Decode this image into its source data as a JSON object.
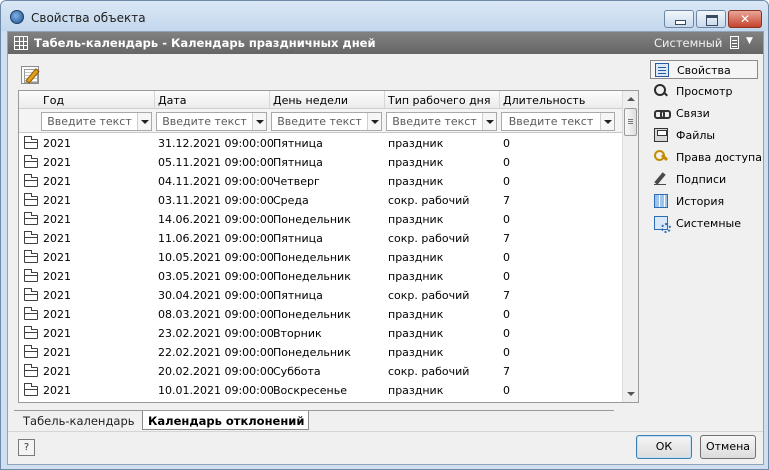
{
  "window": {
    "title": "Свойства объекта"
  },
  "header": {
    "title": "Табель-календарь - Календарь праздничных дней",
    "right_label": "Системный"
  },
  "grid": {
    "columns": [
      "Год",
      "Дата",
      "День недели",
      "Тип рабочего дня",
      "Длительность"
    ],
    "filter_placeholder": "Введите текст",
    "rows": [
      [
        "2021",
        "31.12.2021 09:00:00",
        "Пятница",
        "праздник",
        "0"
      ],
      [
        "2021",
        "05.11.2021 09:00:00",
        "Пятница",
        "праздник",
        "0"
      ],
      [
        "2021",
        "04.11.2021 09:00:00",
        "Четверг",
        "праздник",
        "0"
      ],
      [
        "2021",
        "03.11.2021 09:00:00",
        "Среда",
        "сокр. рабочий",
        "7"
      ],
      [
        "2021",
        "14.06.2021 09:00:00",
        "Понедельник",
        "праздник",
        "0"
      ],
      [
        "2021",
        "11.06.2021 09:00:00",
        "Пятница",
        "сокр. рабочий",
        "7"
      ],
      [
        "2021",
        "10.05.2021 09:00:00",
        "Понедельник",
        "праздник",
        "0"
      ],
      [
        "2021",
        "03.05.2021 09:00:00",
        "Понедельник",
        "праздник",
        "0"
      ],
      [
        "2021",
        "30.04.2021 09:00:00",
        "Пятница",
        "сокр. рабочий",
        "7"
      ],
      [
        "2021",
        "08.03.2021 09:00:00",
        "Понедельник",
        "праздник",
        "0"
      ],
      [
        "2021",
        "23.02.2021 09:00:00",
        "Вторник",
        "праздник",
        "0"
      ],
      [
        "2021",
        "22.02.2021 09:00:00",
        "Понедельник",
        "праздник",
        "0"
      ],
      [
        "2021",
        "20.02.2021 09:00:00",
        "Суббота",
        "сокр. рабочий",
        "7"
      ],
      [
        "2021",
        "10.01.2021 09:00:00",
        "Воскресенье",
        "праздник",
        "0"
      ]
    ]
  },
  "tabs": [
    {
      "label": "Табель-календарь",
      "active": false
    },
    {
      "label": "Календарь отклонений",
      "active": true
    }
  ],
  "side_panel": {
    "items": [
      {
        "label": "Свойства",
        "icon": "properties-icon",
        "active": true
      },
      {
        "label": "Просмотр",
        "icon": "magnifier-icon",
        "active": false
      },
      {
        "label": "Связи",
        "icon": "link-icon",
        "active": false
      },
      {
        "label": "Файлы",
        "icon": "files-icon",
        "active": false
      },
      {
        "label": "Права доступа",
        "icon": "key-icon",
        "active": false
      },
      {
        "label": "Подписи",
        "icon": "pen-icon",
        "active": false
      },
      {
        "label": "История",
        "icon": "history-icon",
        "active": false
      },
      {
        "label": "Системные",
        "icon": "system-icon",
        "active": false
      }
    ]
  },
  "footer": {
    "help_label": "?",
    "ok_label": "ОК",
    "cancel_label": "Отмена"
  },
  "colors": {
    "header_bg": "#6e6e6e",
    "window_frame": "#cfdff0"
  }
}
